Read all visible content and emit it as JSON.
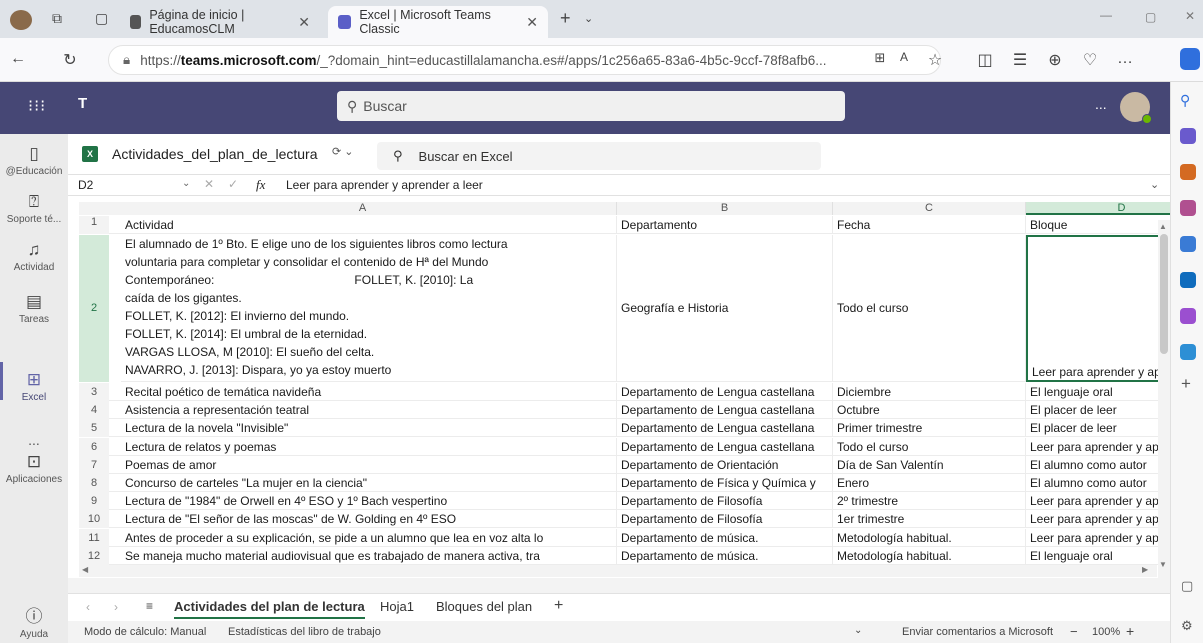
{
  "browser": {
    "tabs": [
      {
        "label": "Página de inicio | EducamosCLM"
      },
      {
        "label": "Excel | Microsoft Teams Classic"
      }
    ],
    "url_prefix": "https://",
    "url_domain": "teams.microsoft.com",
    "url_rest": "/_?domain_hint=educastillalamancha.es#/apps/1c256a65-83a6-4b5c-9ccf-78f8afb6..."
  },
  "teams": {
    "search_placeholder": "Buscar",
    "more_label": "...",
    "rail": [
      {
        "label": "@Educación",
        "icon": "phone-icon"
      },
      {
        "label": "Soporte té...",
        "icon": "help-circle-icon"
      },
      {
        "label": "Actividad",
        "icon": "bell-icon"
      },
      {
        "label": "Tareas",
        "icon": "tasks-icon"
      },
      {
        "label": "Excel",
        "icon": "excel-icon"
      },
      {
        "label": "...",
        "icon": "more-icon"
      },
      {
        "label": "Aplicaciones",
        "icon": "apps-icon"
      },
      {
        "label": "Ayuda",
        "icon": "help-icon"
      }
    ]
  },
  "excel": {
    "file_name": "Actividades_del_plan_de_lectura",
    "search_placeholder": "Buscar en Excel",
    "name_box": "D2",
    "fx_label": "fx",
    "formula": "Leer para aprender y aprender a leer",
    "columns": [
      "A",
      "B",
      "C",
      "D"
    ],
    "header_row": {
      "num": "1",
      "a": "Actividad",
      "b": "Departamento",
      "c": "Fecha",
      "d": "Bloque"
    },
    "row2": {
      "num": "2",
      "a_lines": [
        "El alumnado de 1º Bto. E elige uno de los siguientes libros como lectura",
        "voluntaria para completar y consolidar el contenido de Hª del Mundo",
        "Contemporáneo:                                          FOLLET, K. [2010]: La",
        "caída de los gigantes.",
        "FOLLET, K. [2012]: El invierno del mundo.",
        "FOLLET, K. [2014]: El umbral de la eternidad.",
        "VARGAS LLOSA, M [2010]: El sueño del celta.",
        "NAVARRO, J. [2013]: Dispara, yo ya estoy muerto"
      ],
      "b": "Geografía e Historia",
      "c": "Todo el curso",
      "d": "Leer para aprender y aprender a leer"
    },
    "rows": [
      {
        "num": "3",
        "a": "Recital poético de temática navideña",
        "b": "Departamento de Lengua castellana",
        "c": "Diciembre",
        "d": "El lenguaje oral"
      },
      {
        "num": "4",
        "a": "Asistencia a representación teatral",
        "b": "Departamento de Lengua castellana",
        "c": "Octubre",
        "d": "El placer de leer"
      },
      {
        "num": "5",
        "a": "Lectura de la novela \"Invisible\"",
        "b": "Departamento de Lengua castellana",
        "c": "Primer trimestre",
        "d": "El placer de leer"
      },
      {
        "num": "6",
        "a": "Lectura de relatos y poemas",
        "b": "Departamento de Lengua castellana",
        "c": "Todo el curso",
        "d": "Leer para aprender y aprender a leer"
      },
      {
        "num": "7",
        "a": "Poemas de amor",
        "b": "Departamento de Orientación",
        "c": "Día de San Valentín",
        "d": "El alumno como autor"
      },
      {
        "num": "8",
        "a": "Concurso de carteles \"La mujer en la ciencia\"",
        "b": "Departamento de Física y Química y",
        "c": "Enero",
        "d": "El alumno como autor"
      },
      {
        "num": "9",
        "a": "Lectura de \"1984\" de Orwell en 4º ESO y 1º Bach vespertino",
        "b": "Departamento de Filosofía",
        "c": "2º trimestre",
        "d": "Leer para aprender y aprender a leer"
      },
      {
        "num": "10",
        "a": "Lectura de \"El señor de las moscas\" de W. Golding en 4º ESO",
        "b": "Departamento de Filosofía",
        "c": "1er trimestre",
        "d": "Leer para aprender y aprender a leer"
      },
      {
        "num": "11",
        "a": "Antes de proceder a su explicación, se pide a un alumno que lea en voz alta lo",
        "b": "Departamento de música.",
        "c": "Metodología habitual.",
        "d": "Leer para aprender y aprender a leer"
      },
      {
        "num": "12",
        "a": "Se maneja mucho material audiovisual que es trabajado de manera activa, tra",
        "b": "Departamento de música.",
        "c": "Metodología habitual.",
        "d": "El lenguaje oral"
      }
    ],
    "sheets": [
      "Actividades del plan de lectura",
      "Hoja1",
      "Bloques del plan"
    ],
    "status": {
      "calc_mode": "Modo de cálculo: Manual",
      "stats": "Estadísticas del libro de trabajo",
      "feedback": "Enviar comentarios a Microsoft",
      "zoom": "100%"
    }
  },
  "colors": {
    "teams_purple": "#464775",
    "excel_green": "#217346",
    "accent": "#6264a7"
  }
}
